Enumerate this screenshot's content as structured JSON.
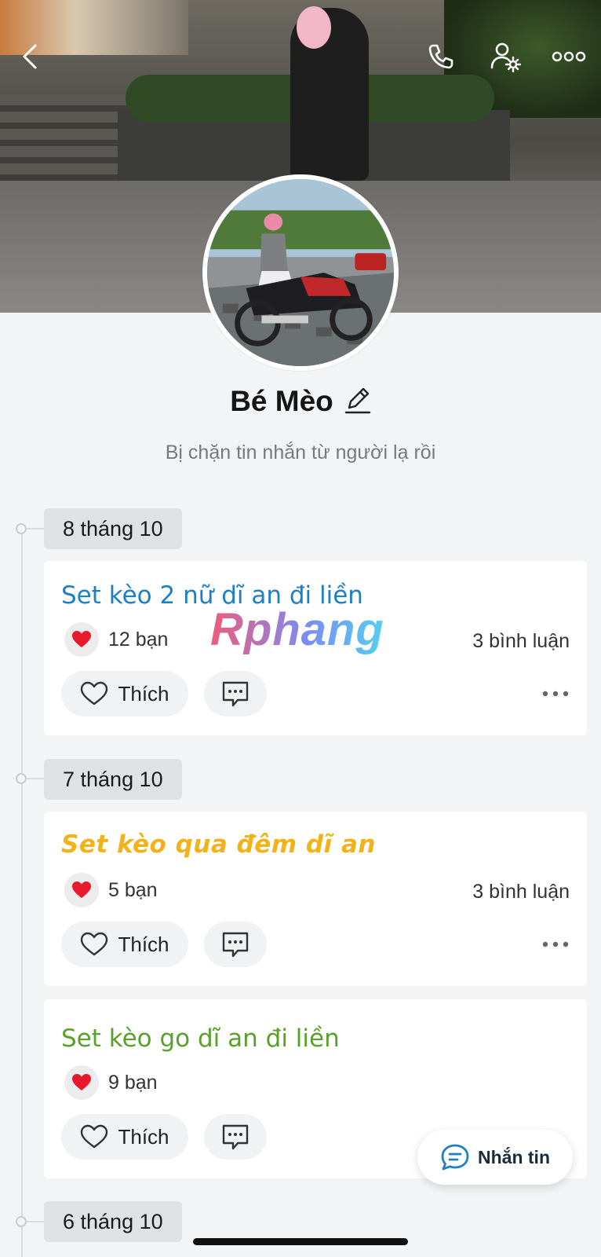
{
  "header": {
    "back_icon": "back-icon",
    "call_icon": "phone-icon",
    "settings_icon": "user-gear-icon",
    "more_icon": "more-icon"
  },
  "profile": {
    "name": "Bé Mèo",
    "edit_icon": "pencil-icon",
    "status": "Bị chặn tin nhắn từ người lạ rồi"
  },
  "feed": {
    "groups": [
      {
        "date": "8 tháng 10",
        "posts": [
          {
            "title": "Set kèo 2 nữ dĩ an đi liền",
            "title_color": "#1d7fc4",
            "likes": "12 bạn",
            "comments": "3 bình luận",
            "like_label": "Thích"
          }
        ]
      },
      {
        "date": "7 tháng 10",
        "posts": [
          {
            "title": "Set kèo qua đêm dĩ an",
            "title_color": "#f2b21a",
            "likes": "5 bạn",
            "comments": "3 bình luận",
            "like_label": "Thích"
          },
          {
            "title": "Set kèo go dĩ an đi liền",
            "title_color": "#5aa12c",
            "likes": "9 bạn",
            "like_label": "Thích"
          }
        ]
      },
      {
        "date": "6 tháng 10",
        "posts": []
      }
    ]
  },
  "watermark": "Rphang",
  "fab": {
    "label": "Nhắn tin",
    "icon": "chat-bubble-icon"
  },
  "colors": {
    "accent": "#1d7fc4",
    "background": "#f2f4f5",
    "heart": "#e8192c"
  }
}
